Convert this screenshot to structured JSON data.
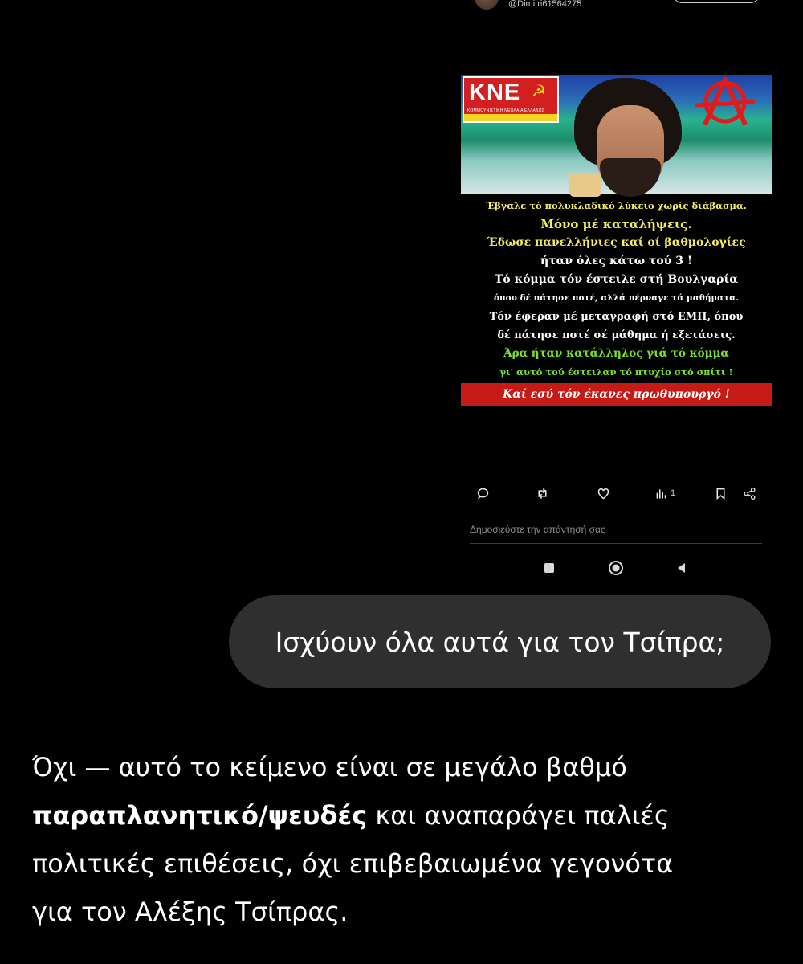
{
  "tweet": {
    "handle": "@Dimitri61564275",
    "meme": {
      "logo_text": "KNE",
      "logo_subtitle": "ΚΟΜΜΟΥΝΙΣΤΙΚΗ ΝΕΟΛΑΙΑ ΕΛΛΑΔΟΣ",
      "lines": [
        "Έβγαλε τό πολυκλαδικό λύκειο χωρίς διάβασμα.",
        "Μόνο μέ καταλήψεις.",
        "Έδωσε πανελλήνιες καί οί βαθμολογίες",
        "ήταν όλες κάτω τού 3 !",
        "Τό κόμμα τόν έστειλε στή Βουλγαρία",
        "όπου δέ πάτησε ποτέ, αλλά πέρναγε τά μαθήματα.",
        "Τόν έφεραν μέ μεταγραφή στό ΕΜΠ, όπου",
        "δέ πάτησε ποτέ σέ μάθημα ή εξετάσεις.",
        "Άρα ήταν κατάλληλος γιά τό κόμμα",
        "γι' αυτό τού έστειλαν τό πτυχίο στό σπίτι !"
      ],
      "footer": "Καί εσύ τόν έκανες πρωθυπουργό !"
    },
    "actions": {
      "views_count": "1"
    },
    "reply_placeholder": "Δημοσιεύστε την απάντησή σας"
  },
  "chat": {
    "user_message": "Ισχύουν όλα αυτά για τον Τσίπρα;",
    "answer": {
      "line1": "Όχι — αυτό το κείμενο είναι σε μεγάλο βαθμό",
      "bold": "παραπλανητικό/ψευδές",
      "line2_rest": " και αναπαράγει παλιές",
      "line3": "πολιτικές επιθέσεις, όχι επιβεβαιωμένα γεγονότα",
      "line4": "για τον Αλέξης Τσίπρας."
    }
  },
  "colors": {
    "background": "#000000",
    "bubble": "#2f2f2f",
    "meme_yellow": "#f4ec64",
    "meme_green": "#7ee02e",
    "meme_red": "#c41b16"
  }
}
